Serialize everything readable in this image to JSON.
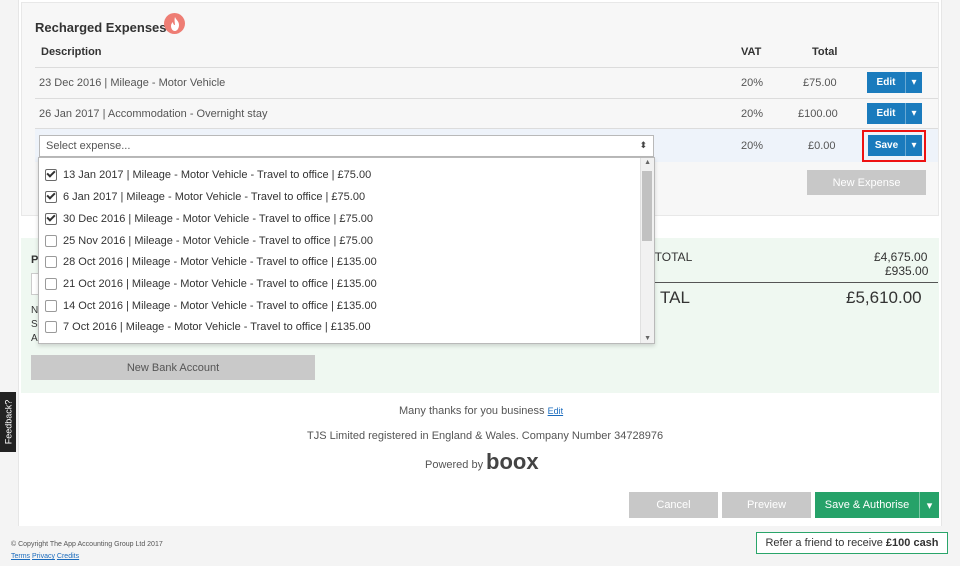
{
  "recharged": {
    "title": "Recharged Expenses",
    "icon": "fire-icon",
    "headers": {
      "description": "Description",
      "vat": "VAT",
      "total": "Total"
    },
    "rows": [
      {
        "description": "23 Dec 2016 | Mileage - Motor Vehicle",
        "vat": "20%",
        "total": "£75.00",
        "action": "Edit"
      },
      {
        "description": "26 Jan 2017 | Accommodation - Overnight stay",
        "vat": "20%",
        "total": "£100.00",
        "action": "Edit"
      }
    ],
    "active_row": {
      "placeholder": "Select expense...",
      "vat": "20%",
      "total": "£0.00",
      "action": "Save"
    },
    "new_expense_label": "New Expense"
  },
  "dropdown": {
    "options": [
      {
        "label": "13 Jan 2017 | Mileage - Motor Vehicle - Travel to office | £75.00",
        "checked": true
      },
      {
        "label": "6 Jan 2017 | Mileage - Motor Vehicle - Travel to office | £75.00",
        "checked": true
      },
      {
        "label": "30 Dec 2016 | Mileage - Motor Vehicle - Travel to office | £75.00",
        "checked": true
      },
      {
        "label": "25 Nov 2016 | Mileage - Motor Vehicle - Travel to office | £75.00",
        "checked": false
      },
      {
        "label": "28 Oct 2016 | Mileage - Motor Vehicle - Travel to office | £135.00",
        "checked": false
      },
      {
        "label": "21 Oct 2016 | Mileage - Motor Vehicle - Travel to office | £135.00",
        "checked": false
      },
      {
        "label": "14 Oct 2016 | Mileage - Motor Vehicle - Travel to office | £135.00",
        "checked": false
      },
      {
        "label": "7 Oct 2016 | Mileage - Motor Vehicle - Travel to office | £135.00",
        "checked": false
      }
    ]
  },
  "totals": {
    "subtotal_label_partial": "3TOTAL",
    "subtotal_value": "£4,675.00",
    "vat_value": "£935.00",
    "total_label_partial": "TAL",
    "total_value": "£5,610.00",
    "left_fragments": [
      "P",
      "N",
      "S",
      "A"
    ],
    "new_bank_account_label": "New Bank Account"
  },
  "footer_notes": {
    "thanks_text": "Many thanks for you business",
    "thanks_edit_link": "Edit",
    "registration": "TJS Limited registered in England & Wales. Company Number 34728976",
    "powered_by": "Powered by",
    "brand": "boox"
  },
  "actions": {
    "cancel": "Cancel",
    "preview": "Preview",
    "save_authorise": "Save & Authorise"
  },
  "page_footer": {
    "copyright": "© Copyright The App Accounting Group Ltd 2017",
    "links": [
      "Terms",
      "Privacy",
      "Credits"
    ],
    "refer_prefix": "Refer a friend to receive",
    "refer_amount": "£100 cash"
  },
  "feedback_label": "Feedback?",
  "colors": {
    "primary_blue": "#1a7bbd",
    "green": "#26a269",
    "highlight_red": "#e11111",
    "fire_badge": "#ee7d74"
  }
}
